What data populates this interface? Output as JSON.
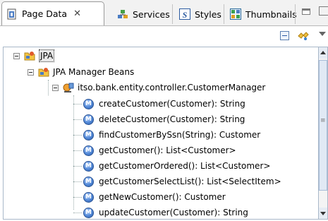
{
  "tabs": [
    {
      "label": "Page Data",
      "icon": "page-data-icon",
      "close": "✕",
      "active": true
    },
    {
      "label": "Services",
      "icon": "services-icon"
    },
    {
      "label": "Styles",
      "icon": "styles-icon"
    },
    {
      "label": "Thumbnails",
      "icon": "thumbnails-icon"
    }
  ],
  "tree": {
    "root": "JPA",
    "group": "JPA Manager Beans",
    "bean": "itso.bank.entity.controller.CustomerManager",
    "method_icon_letter": "M",
    "methods": [
      "createCustomer(Customer): String",
      "deleteCustomer(Customer): String",
      "findCustomerBySsn(String): Customer",
      "getCustomer(): List<Customer>",
      "getCustomerOrdered(): List<Customer>",
      "getCustomerSelectList(): List<SelectItem>",
      "getNewCustomer(): Customer",
      "updateCustomer(Customer): String"
    ]
  },
  "colors": {
    "method_icon": "#4f86d6",
    "tab_border": "#9a9a9a",
    "tree_border": "#a9b8c9"
  }
}
